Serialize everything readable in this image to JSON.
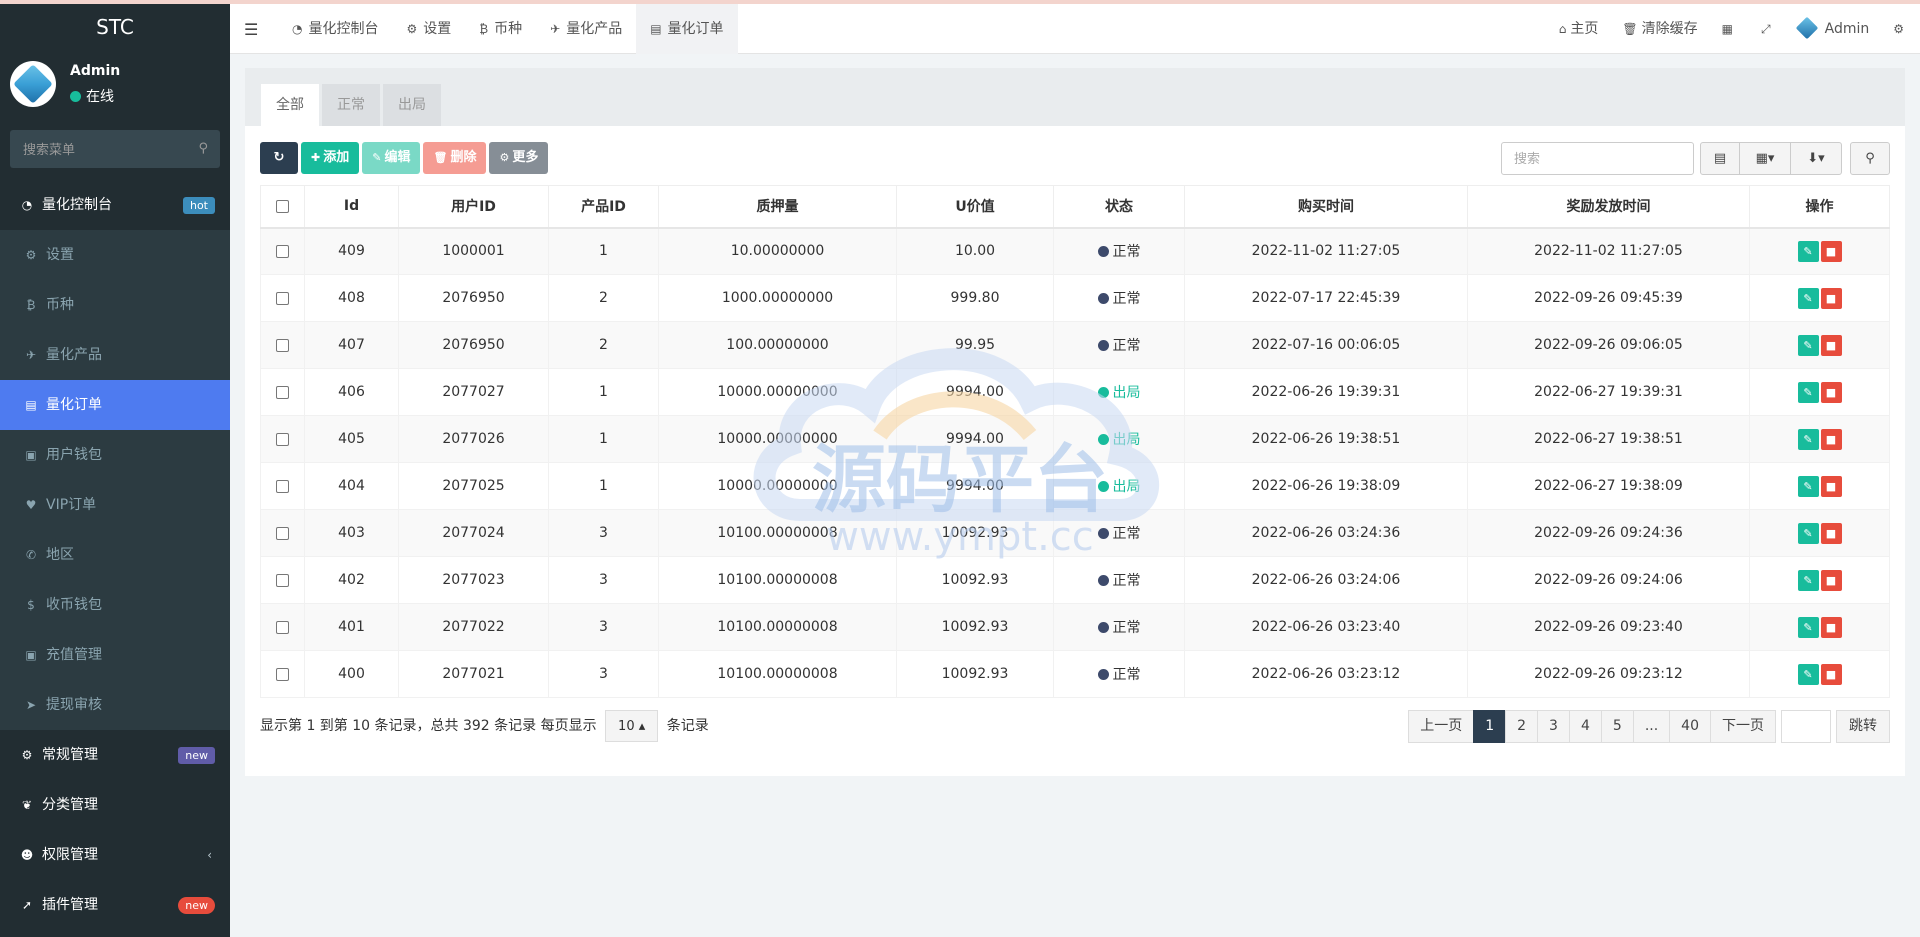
{
  "app": {
    "logo": "STC"
  },
  "user": {
    "name": "Admin",
    "status": "在线"
  },
  "sidebar": {
    "search_placeholder": "搜索菜单",
    "items": [
      {
        "label": "量化控制台",
        "badge": "hot"
      },
      {
        "label": "设置"
      },
      {
        "label": "币种"
      },
      {
        "label": "量化产品"
      },
      {
        "label": "量化订单"
      },
      {
        "label": "用户钱包"
      },
      {
        "label": "VIP订单"
      },
      {
        "label": "地区"
      },
      {
        "label": "收币钱包"
      },
      {
        "label": "充值管理"
      },
      {
        "label": "提现审核"
      },
      {
        "label": "常规管理",
        "badge": "new"
      },
      {
        "label": "分类管理"
      },
      {
        "label": "权限管理"
      },
      {
        "label": "插件管理",
        "badge": "new"
      }
    ]
  },
  "header": {
    "tabs": [
      "量化控制台",
      "设置",
      "币种",
      "量化产品",
      "量化订单"
    ],
    "right": {
      "home": "主页",
      "clear_cache": "清除缓存",
      "admin": "Admin"
    }
  },
  "content_tabs": [
    "全部",
    "正常",
    "出局"
  ],
  "toolbar": {
    "add": "添加",
    "edit": "编辑",
    "delete": "删除",
    "more": "更多",
    "search_placeholder": "搜索"
  },
  "table": {
    "headers": [
      "Id",
      "用户ID",
      "产品ID",
      "质押量",
      "U价值",
      "状态",
      "购买时间",
      "奖励发放时间",
      "操作"
    ],
    "rows": [
      {
        "id": "409",
        "user_id": "1000001",
        "product_id": "1",
        "amount": "10.00000000",
        "u_value": "10.00",
        "status": "正常",
        "buy_time": "2022-11-02 11:27:05",
        "reward_time": "2022-11-02 11:27:05"
      },
      {
        "id": "408",
        "user_id": "2076950",
        "product_id": "2",
        "amount": "1000.00000000",
        "u_value": "999.80",
        "status": "正常",
        "buy_time": "2022-07-17 22:45:39",
        "reward_time": "2022-09-26 09:45:39"
      },
      {
        "id": "407",
        "user_id": "2076950",
        "product_id": "2",
        "amount": "100.00000000",
        "u_value": "99.95",
        "status": "正常",
        "buy_time": "2022-07-16 00:06:05",
        "reward_time": "2022-09-26 09:06:05"
      },
      {
        "id": "406",
        "user_id": "2077027",
        "product_id": "1",
        "amount": "10000.00000000",
        "u_value": "9994.00",
        "status": "出局",
        "buy_time": "2022-06-26 19:39:31",
        "reward_time": "2022-06-27 19:39:31"
      },
      {
        "id": "405",
        "user_id": "2077026",
        "product_id": "1",
        "amount": "10000.00000000",
        "u_value": "9994.00",
        "status": "出局",
        "buy_time": "2022-06-26 19:38:51",
        "reward_time": "2022-06-27 19:38:51"
      },
      {
        "id": "404",
        "user_id": "2077025",
        "product_id": "1",
        "amount": "10000.00000000",
        "u_value": "9994.00",
        "status": "出局",
        "buy_time": "2022-06-26 19:38:09",
        "reward_time": "2022-06-27 19:38:09"
      },
      {
        "id": "403",
        "user_id": "2077024",
        "product_id": "3",
        "amount": "10100.00000008",
        "u_value": "10092.93",
        "status": "正常",
        "buy_time": "2022-06-26 03:24:36",
        "reward_time": "2022-09-26 09:24:36"
      },
      {
        "id": "402",
        "user_id": "2077023",
        "product_id": "3",
        "amount": "10100.00000008",
        "u_value": "10092.93",
        "status": "正常",
        "buy_time": "2022-06-26 03:24:06",
        "reward_time": "2022-09-26 09:24:06"
      },
      {
        "id": "401",
        "user_id": "2077022",
        "product_id": "3",
        "amount": "10100.00000008",
        "u_value": "10092.93",
        "status": "正常",
        "buy_time": "2022-06-26 03:23:40",
        "reward_time": "2022-09-26 09:23:40"
      },
      {
        "id": "400",
        "user_id": "2077021",
        "product_id": "3",
        "amount": "10100.00000008",
        "u_value": "10092.93",
        "status": "正常",
        "buy_time": "2022-06-26 03:23:12",
        "reward_time": "2022-09-26 09:23:12"
      }
    ]
  },
  "footer": {
    "info_prefix": "显示第 1 到第 10 条记录，总共 392 条记录 每页显示",
    "page_size": "10",
    "info_suffix": "条记录",
    "pager": {
      "prev": "上一页",
      "pages": [
        "1",
        "2",
        "3",
        "4",
        "5",
        "...",
        "40"
      ],
      "next": "下一页",
      "jump": "跳转"
    }
  },
  "watermark": {
    "text": "源码平台",
    "url": "www.ympt.cc"
  },
  "colors": {
    "status_normal": "#3d4a6b",
    "status_out": "#18bc9c",
    "active_menu": "#4e7bf0"
  }
}
